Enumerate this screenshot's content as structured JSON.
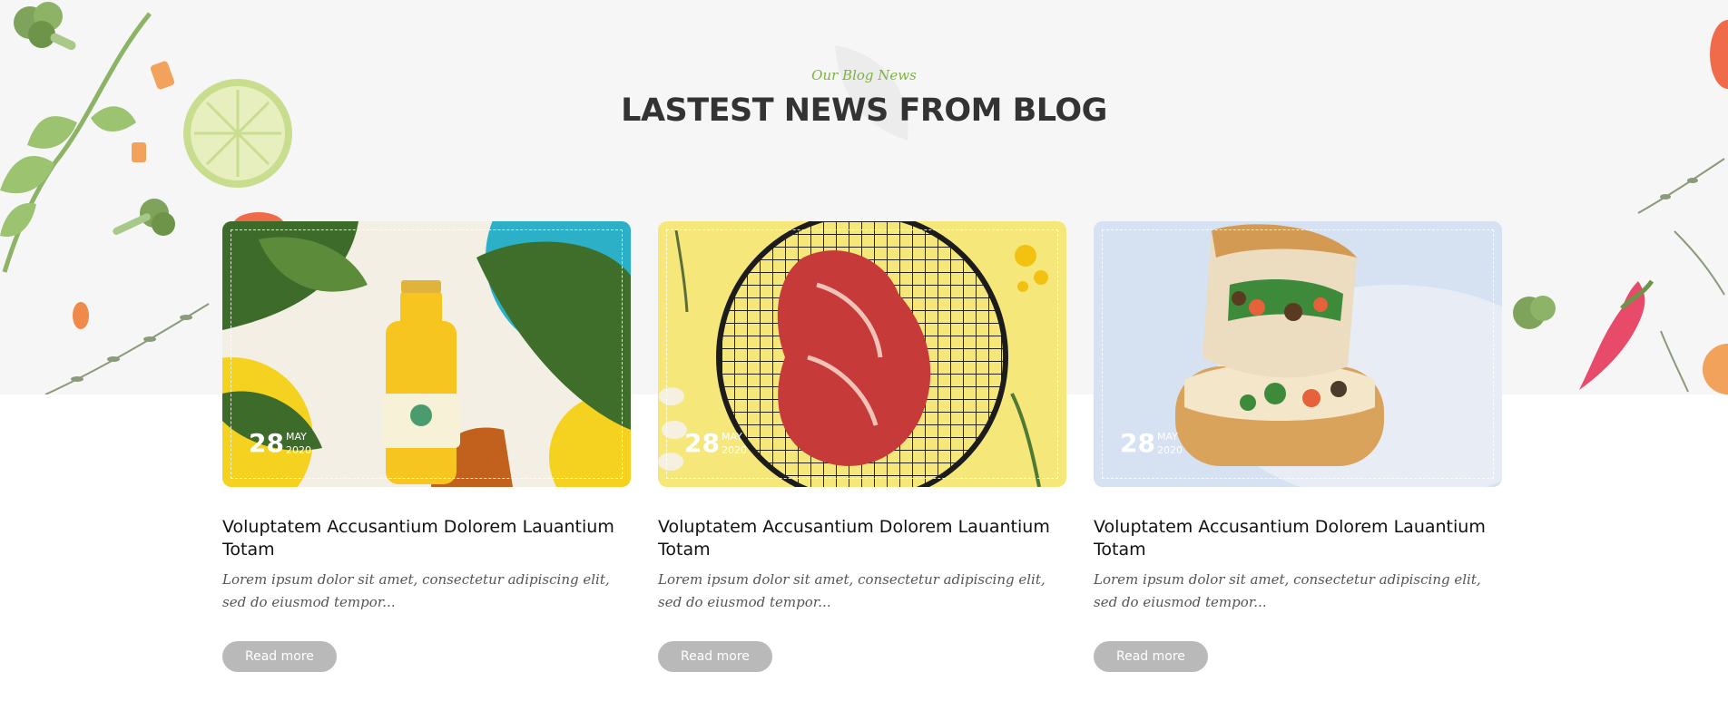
{
  "section": {
    "subtitle": "Our Blog News",
    "title": "LASTEST NEWS FROM BLOG"
  },
  "posts": [
    {
      "image_icon": "juice-bottle-image",
      "date_day": "28",
      "date_month": "MAY",
      "date_year": "2020",
      "title": "Voluptatem Accusantium Dolorem Lauantium Totam",
      "excerpt": "Lorem ipsum dolor sit amet, consectetur adipiscing elit, sed do eiusmod tempor...",
      "read_more": "Read more"
    },
    {
      "image_icon": "steak-image",
      "date_day": "28",
      "date_month": "MAY",
      "date_year": "2020",
      "title": "Voluptatem Accusantium Dolorem Lauantium Totam",
      "excerpt": "Lorem ipsum dolor sit amet, consectetur adipiscing elit, sed do eiusmod tempor...",
      "read_more": "Read more"
    },
    {
      "image_icon": "sandwich-image",
      "date_day": "28",
      "date_month": "MAY",
      "date_year": "2020",
      "title": "Voluptatem Accusantium Dolorem Lauantium Totam",
      "excerpt": "Lorem ipsum dolor sit amet, consectetur adipiscing elit, sed do eiusmod tempor...",
      "read_more": "Read more"
    }
  ],
  "colors": {
    "accent": "#7cb342",
    "title": "#333333",
    "button": "#b9b9b9",
    "hero_bg": "#f6f6f6"
  }
}
